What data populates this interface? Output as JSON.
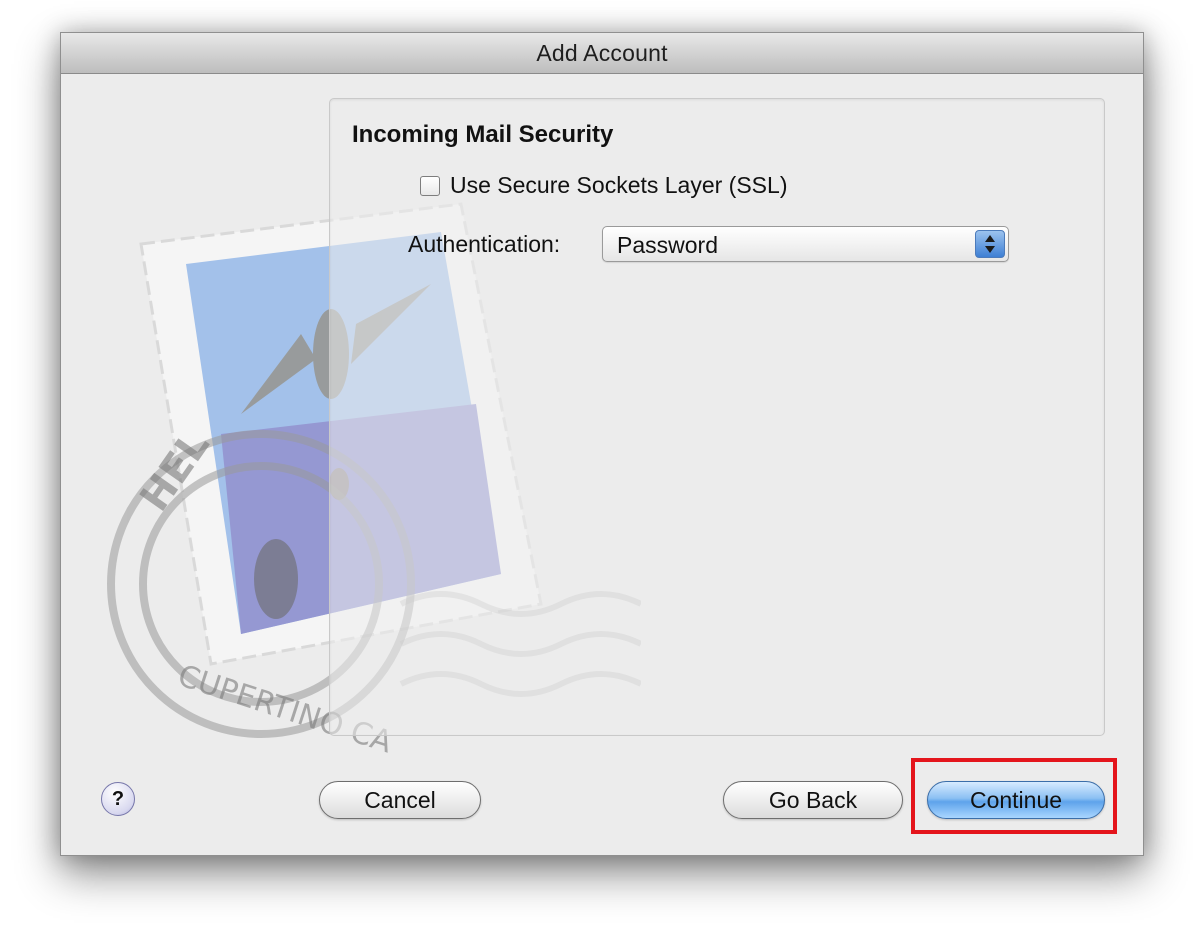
{
  "window": {
    "title": "Add Account"
  },
  "panel": {
    "heading": "Incoming Mail Security",
    "ssl_checkbox": {
      "label": "Use Secure Sockets Layer (SSL)",
      "checked": false
    },
    "authentication": {
      "label": "Authentication:",
      "selected": "Password"
    }
  },
  "stamp": {
    "postmark_text_top": "HEL",
    "postmark_text_bottom": "CUPERTINO CA"
  },
  "buttons": {
    "help_label": "?",
    "cancel_label": "Cancel",
    "go_back_label": "Go Back",
    "continue_label": "Continue"
  },
  "colors": {
    "accent": "#5ea3eb",
    "highlight": "#e4151c"
  },
  "icons": {
    "help": "help-icon",
    "popup_arrows": "updown-arrows-icon",
    "mail_stamp": "mail-stamp-icon"
  }
}
